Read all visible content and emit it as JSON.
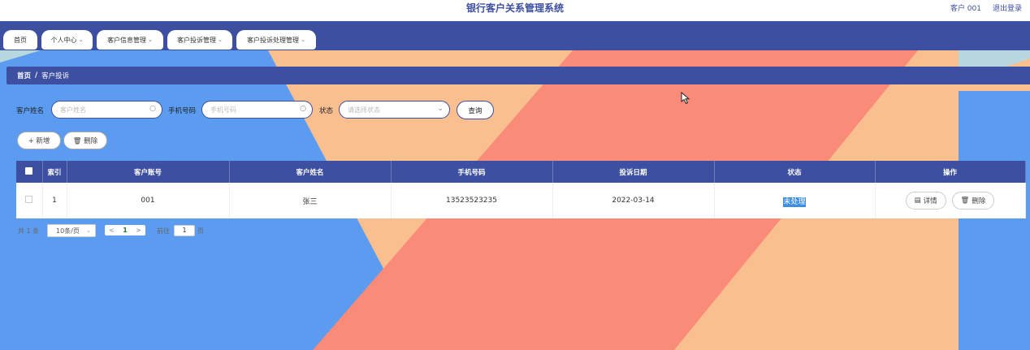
{
  "app": {
    "title": "银行客户关系管理系统"
  },
  "user": {
    "name": "客户 001",
    "logout": "退出登录"
  },
  "nav": {
    "items": [
      {
        "label": "首页",
        "chevron": ""
      },
      {
        "label": "个人中心",
        "chevron": "⌄"
      },
      {
        "label": "客户信息管理",
        "chevron": "⌄"
      },
      {
        "label": "客户投诉管理",
        "chevron": "⌄"
      },
      {
        "label": "客户投诉处理管理",
        "chevron": "⌄"
      }
    ]
  },
  "breadcrumb": {
    "home": "首页",
    "separator": "/",
    "current": "客户投诉"
  },
  "search": {
    "name_label": "客户姓名",
    "name_placeholder": "客户姓名",
    "phone_label": "手机号码",
    "phone_placeholder": "手机号码",
    "status_label": "状态",
    "status_placeholder": "请选择状态",
    "query_label": "查询"
  },
  "actions": {
    "add_label": "+ 新增",
    "delete_label": "🗑 删除"
  },
  "table": {
    "columns": [
      "",
      "索引",
      "客户账号",
      "客户姓名",
      "手机号码",
      "投诉日期",
      "状态",
      "操作"
    ],
    "rows": [
      {
        "index": "1",
        "account": "001",
        "name": "张三",
        "phone": "13523523235",
        "date": "2022-03-14",
        "status": "未处理",
        "detail_label": "详情",
        "delete_label": "删除"
      }
    ]
  },
  "pager": {
    "total": "共 1 条",
    "page_size": "10条/页",
    "prev": "<",
    "current": "1",
    "next": ">",
    "goto_label": "前往",
    "goto_value": "1",
    "page_suffix": "页"
  },
  "colors": {
    "primary": "#3d4fa0",
    "bg_blue": "#5b9cf0",
    "bg_peach": "#f9bf8f",
    "bg_salmon": "#fb8b79",
    "selection": "#3c8ee0"
  },
  "icons": {
    "search": "search-icon",
    "select": "chevron-down-icon",
    "detail": "document-icon",
    "delete": "trash-icon",
    "add": "plus-icon"
  }
}
